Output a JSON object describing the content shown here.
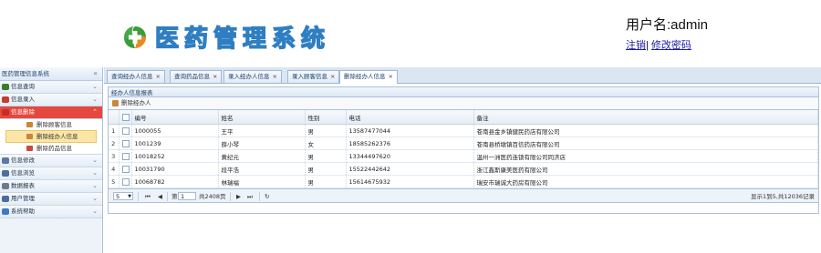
{
  "header": {
    "app_title": "医药管理系统",
    "user_label": "用户名:admin",
    "logout_link": "注销",
    "link_separator": "|",
    "change_password_link": "修改密码",
    "logo_colors": {
      "green": "#3b9c3b",
      "orange": "#e58a24"
    }
  },
  "sidebar": {
    "title": "医药管理信息系统",
    "collapse_icon": "«",
    "items": [
      {
        "label": "信息查询",
        "icon": "query-icon",
        "color": "#3a7d2c",
        "arrow": "⌄"
      },
      {
        "label": "信息录入",
        "icon": "input-icon",
        "color": "#c83b2e",
        "arrow": "⌄"
      },
      {
        "label": "信息删除",
        "icon": "delete-icon",
        "color": "#c42c24",
        "arrow": "⌃",
        "active": true,
        "children": [
          {
            "label": "删除顾客信息",
            "icon": "customer-icon",
            "color": "#c9863c"
          },
          {
            "label": "删除经办人信息",
            "icon": "agent-icon",
            "color": "#c9863c",
            "selected": true
          },
          {
            "label": "删除药品信息",
            "icon": "medicine-icon",
            "color": "#c84a3e"
          }
        ]
      },
      {
        "label": "信息修改",
        "icon": "edit-icon",
        "color": "#5a77a8",
        "arrow": "⌄"
      },
      {
        "label": "信息浏览",
        "icon": "browse-icon",
        "color": "#4d6f9b",
        "arrow": "⌄"
      },
      {
        "label": "数据报表",
        "icon": "report-icon",
        "color": "#6b7b8f",
        "arrow": "⌄"
      },
      {
        "label": "用户管理",
        "icon": "user-icon",
        "color": "#4b6c9e",
        "arrow": "⌄"
      },
      {
        "label": "系统帮助",
        "icon": "help-icon",
        "color": "#3d7ac2",
        "arrow": "⌄"
      }
    ]
  },
  "tabs": [
    {
      "label": "查询经办人信息"
    },
    {
      "label": "查询药品信息"
    },
    {
      "label": "录入经办人信息"
    },
    {
      "label": "录入顾客信息"
    },
    {
      "label": "删除经办人信息",
      "active": true
    }
  ],
  "tab_close": "×",
  "panel": {
    "title": "经办人信息报表",
    "delete_button": "删除经办人"
  },
  "table": {
    "columns": [
      "编号",
      "姓名",
      "性别",
      "电话",
      "备注"
    ],
    "rows": [
      {
        "n": "1",
        "id": "1000055",
        "name": "王平",
        "sex": "男",
        "phone": "13587477044",
        "note": "苍南县金乡镇健民药店有限公司"
      },
      {
        "n": "2",
        "id": "1001239",
        "name": "薛小琴",
        "sex": "女",
        "phone": "18585262376",
        "note": "苍南县桥墩镇百信药店有限公司"
      },
      {
        "n": "3",
        "id": "10018252",
        "name": "黄纪元",
        "sex": "男",
        "phone": "13344497620",
        "note": "温州一洲医药连锁有限公司同济店"
      },
      {
        "n": "4",
        "id": "10031790",
        "name": "段平浩",
        "sex": "男",
        "phone": "15522442642",
        "note": "浙江鑫斯康美医药有限公司"
      },
      {
        "n": "5",
        "id": "10068782",
        "name": "林瑞福",
        "sex": "男",
        "phone": "15614675932",
        "note": "瑞安市瑞诚大药房有限公司"
      }
    ]
  },
  "pager": {
    "page_size": "5",
    "page_prefix": "第",
    "page_number": "1",
    "page_suffix": "共2408页",
    "first": "⏮",
    "prev": "◀",
    "next": "▶",
    "last": "⏭",
    "refresh": "↻",
    "info": "显示1到5,共12036记录"
  }
}
